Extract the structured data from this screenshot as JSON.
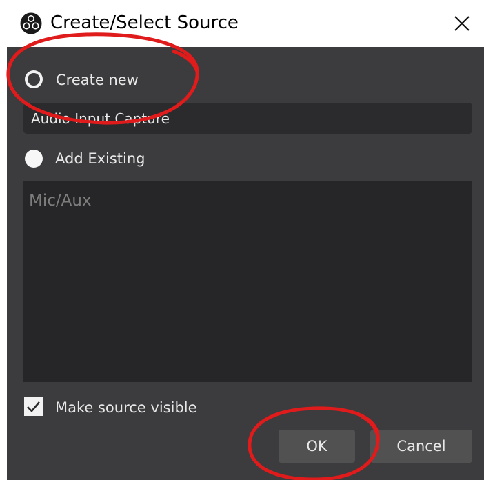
{
  "window": {
    "title": "Create/Select Source",
    "app_icon": "obs-logo-icon",
    "close_icon": "close-icon"
  },
  "options": {
    "create_new_label": "Create new",
    "source_name_value": "Audio Input Capture",
    "add_existing_label": "Add Existing"
  },
  "existing_sources": [
    "Mic/Aux"
  ],
  "make_visible": {
    "label": "Make source visible",
    "checked": true
  },
  "buttons": {
    "ok_label": "OK",
    "cancel_label": "Cancel"
  },
  "colors": {
    "dialog_bg": "#3c3b3d",
    "input_bg": "#2b2a2c",
    "list_bg": "#262527",
    "button_bg": "#525152",
    "annotation_red": "#e01b1b"
  }
}
